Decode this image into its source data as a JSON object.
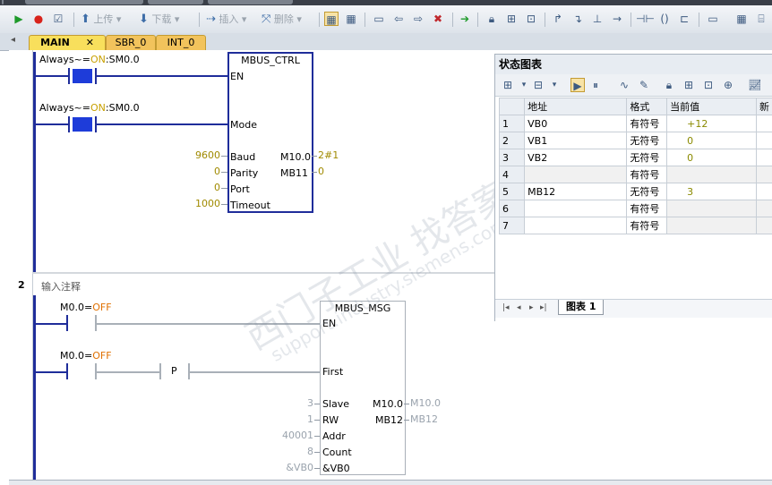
{
  "toolbar": {
    "upload_label": "上传",
    "download_label": "下载",
    "insert_label": "插入",
    "delete_label": "删除"
  },
  "tabs": [
    "MAIN",
    "SBR_0",
    "INT_0"
  ],
  "network1": {
    "contact1_label": "Always~=",
    "contact1_state": "ON",
    "contact1_addr": ":SM0.0",
    "contact2_label": "Always~=",
    "contact2_state": "ON",
    "contact2_addr": ":SM0.0",
    "block_name": "MBUS_CTRL",
    "pins": {
      "en": "EN",
      "mode": "Mode",
      "baud": "Baud",
      "parity": "Parity",
      "port": "Port",
      "timeout": "Timeout",
      "done": "M10.0",
      "error": "MB11"
    },
    "values": {
      "baud": "9600",
      "parity": "0",
      "port": "0",
      "timeout": "1000",
      "done": "2#1",
      "error": "0"
    }
  },
  "network2": {
    "number": "2",
    "comment": "输入注释",
    "contact1_addr": "M0.0=",
    "contact1_state": "OFF",
    "contact2_addr": "M0.0=",
    "contact2_state": "OFF",
    "p_label": "P",
    "block_name": "MBUS_MSG",
    "pins": {
      "en": "EN",
      "first": "First",
      "slave": "Slave",
      "rw": "RW",
      "addr": "Addr",
      "count": "Count",
      "dataptr": "&VB0",
      "done": "M10.0",
      "error": "MB12"
    },
    "values": {
      "slave": "3",
      "rw": "1",
      "addr": "40001",
      "count": "8",
      "dataptr": "&VB0",
      "done": "M10.0",
      "error": "MB12"
    }
  },
  "status_chart": {
    "title": "状态图表",
    "headers": [
      "地址",
      "格式",
      "当前值",
      "新"
    ],
    "rows": [
      {
        "n": "1",
        "addr": "VB0",
        "fmt": "有符号",
        "val": "+12"
      },
      {
        "n": "2",
        "addr": "VB1",
        "fmt": "无符号",
        "val": "0"
      },
      {
        "n": "3",
        "addr": "VB2",
        "fmt": "无符号",
        "val": "0"
      },
      {
        "n": "4",
        "addr": "",
        "fmt": "有符号",
        "val": ""
      },
      {
        "n": "5",
        "addr": "MB12",
        "fmt": "无符号",
        "val": "3"
      },
      {
        "n": "6",
        "addr": "",
        "fmt": "有符号",
        "val": ""
      },
      {
        "n": "7",
        "addr": "",
        "fmt": "有符号",
        "val": ""
      }
    ],
    "tab_label": "图表 1"
  },
  "watermark": {
    "cn": "西门子工业 找答案",
    "url": "support.industry.siemens.com/cs"
  }
}
